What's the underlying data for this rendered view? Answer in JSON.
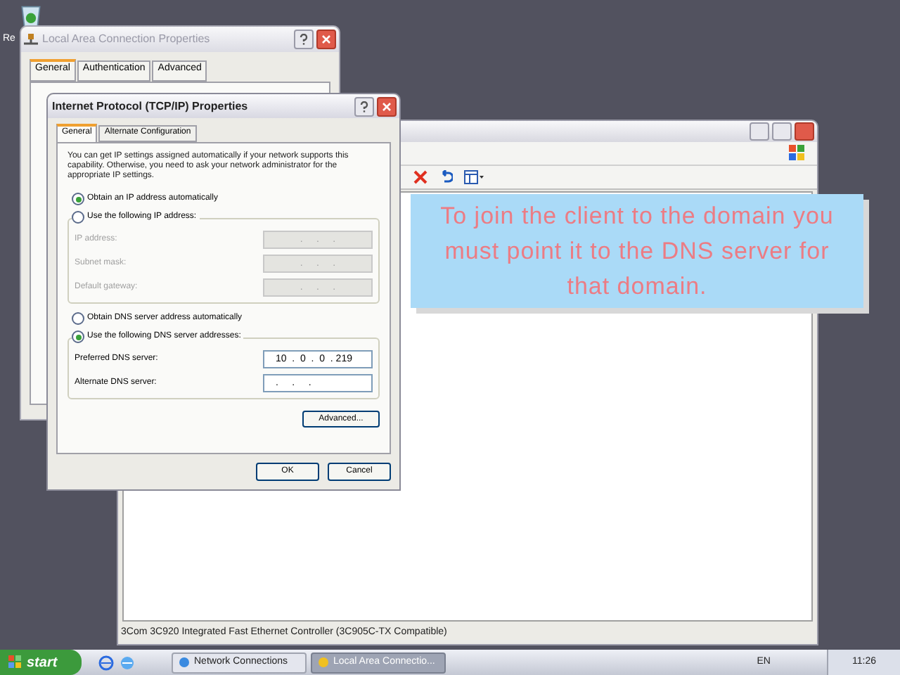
{
  "desktop_icons": [
    {
      "label": "Re"
    }
  ],
  "back_window": {
    "title": "Local Area Connection Properties",
    "tabs": [
      {
        "label": "General",
        "selected": true
      },
      {
        "label": "Authentication",
        "selected": false
      },
      {
        "label": "Advanced",
        "selected": false
      }
    ]
  },
  "main_window": {
    "status_text": "3Com 3C920 Integrated Fast Ethernet Controller (3C905C-TX Compatible)"
  },
  "callout": {
    "text": "To join the client to the domain you must point it to the DNS server for that domain."
  },
  "dialog": {
    "title": "Internet Protocol (TCP/IP) Properties",
    "tabs": [
      {
        "label": "General",
        "selected": true
      },
      {
        "label": "Alternate Configuration",
        "selected": false
      }
    ],
    "description": "You can get IP settings assigned automatically if your network supports this capability. Otherwise, you need to ask your network administrator for the appropriate IP settings.",
    "ip_options": [
      {
        "label": "Obtain an IP address automatically",
        "selected": true
      },
      {
        "label": "Use the following IP address:",
        "selected": false
      }
    ],
    "ip_fields": [
      {
        "label": "IP address:",
        "value": ".     .     .",
        "disabled": true
      },
      {
        "label": "Subnet mask:",
        "value": ".     .     .",
        "disabled": true
      },
      {
        "label": "Default gateway:",
        "value": ".     .     .",
        "disabled": true
      }
    ],
    "dns_options": [
      {
        "label": "Obtain DNS server address automatically",
        "selected": false
      },
      {
        "label": "Use the following DNS server addresses:",
        "selected": true
      }
    ],
    "dns_fields": [
      {
        "label": "Preferred DNS server:",
        "value": "10  .  0  .  0  . 219",
        "disabled": false
      },
      {
        "label": "Alternate DNS server:",
        "value": ".     .     .",
        "disabled": false
      }
    ],
    "advanced_button": "Advanced...",
    "buttons": [
      "OK",
      "Cancel"
    ]
  },
  "taskbar": {
    "start": "start",
    "tasks": [
      {
        "label": "Network Connections",
        "selected": false
      },
      {
        "label": "Local Area Connectio...",
        "selected": true
      }
    ],
    "language": "EN",
    "clock": "11:26"
  }
}
